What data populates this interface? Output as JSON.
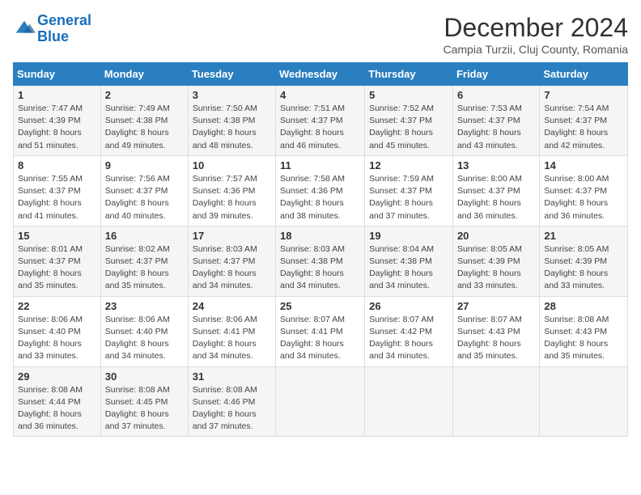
{
  "header": {
    "logo_line1": "General",
    "logo_line2": "Blue",
    "month_title": "December 2024",
    "subtitle": "Campia Turzii, Cluj County, Romania"
  },
  "days_of_week": [
    "Sunday",
    "Monday",
    "Tuesday",
    "Wednesday",
    "Thursday",
    "Friday",
    "Saturday"
  ],
  "weeks": [
    [
      {
        "day": "1",
        "sunrise": "7:47 AM",
        "sunset": "4:39 PM",
        "daylight": "8 hours and 51 minutes."
      },
      {
        "day": "2",
        "sunrise": "7:49 AM",
        "sunset": "4:38 PM",
        "daylight": "8 hours and 49 minutes."
      },
      {
        "day": "3",
        "sunrise": "7:50 AM",
        "sunset": "4:38 PM",
        "daylight": "8 hours and 48 minutes."
      },
      {
        "day": "4",
        "sunrise": "7:51 AM",
        "sunset": "4:37 PM",
        "daylight": "8 hours and 46 minutes."
      },
      {
        "day": "5",
        "sunrise": "7:52 AM",
        "sunset": "4:37 PM",
        "daylight": "8 hours and 45 minutes."
      },
      {
        "day": "6",
        "sunrise": "7:53 AM",
        "sunset": "4:37 PM",
        "daylight": "8 hours and 43 minutes."
      },
      {
        "day": "7",
        "sunrise": "7:54 AM",
        "sunset": "4:37 PM",
        "daylight": "8 hours and 42 minutes."
      }
    ],
    [
      {
        "day": "8",
        "sunrise": "7:55 AM",
        "sunset": "4:37 PM",
        "daylight": "8 hours and 41 minutes."
      },
      {
        "day": "9",
        "sunrise": "7:56 AM",
        "sunset": "4:37 PM",
        "daylight": "8 hours and 40 minutes."
      },
      {
        "day": "10",
        "sunrise": "7:57 AM",
        "sunset": "4:36 PM",
        "daylight": "8 hours and 39 minutes."
      },
      {
        "day": "11",
        "sunrise": "7:58 AM",
        "sunset": "4:36 PM",
        "daylight": "8 hours and 38 minutes."
      },
      {
        "day": "12",
        "sunrise": "7:59 AM",
        "sunset": "4:37 PM",
        "daylight": "8 hours and 37 minutes."
      },
      {
        "day": "13",
        "sunrise": "8:00 AM",
        "sunset": "4:37 PM",
        "daylight": "8 hours and 36 minutes."
      },
      {
        "day": "14",
        "sunrise": "8:00 AM",
        "sunset": "4:37 PM",
        "daylight": "8 hours and 36 minutes."
      }
    ],
    [
      {
        "day": "15",
        "sunrise": "8:01 AM",
        "sunset": "4:37 PM",
        "daylight": "8 hours and 35 minutes."
      },
      {
        "day": "16",
        "sunrise": "8:02 AM",
        "sunset": "4:37 PM",
        "daylight": "8 hours and 35 minutes."
      },
      {
        "day": "17",
        "sunrise": "8:03 AM",
        "sunset": "4:37 PM",
        "daylight": "8 hours and 34 minutes."
      },
      {
        "day": "18",
        "sunrise": "8:03 AM",
        "sunset": "4:38 PM",
        "daylight": "8 hours and 34 minutes."
      },
      {
        "day": "19",
        "sunrise": "8:04 AM",
        "sunset": "4:38 PM",
        "daylight": "8 hours and 34 minutes."
      },
      {
        "day": "20",
        "sunrise": "8:05 AM",
        "sunset": "4:39 PM",
        "daylight": "8 hours and 33 minutes."
      },
      {
        "day": "21",
        "sunrise": "8:05 AM",
        "sunset": "4:39 PM",
        "daylight": "8 hours and 33 minutes."
      }
    ],
    [
      {
        "day": "22",
        "sunrise": "8:06 AM",
        "sunset": "4:40 PM",
        "daylight": "8 hours and 33 minutes."
      },
      {
        "day": "23",
        "sunrise": "8:06 AM",
        "sunset": "4:40 PM",
        "daylight": "8 hours and 34 minutes."
      },
      {
        "day": "24",
        "sunrise": "8:06 AM",
        "sunset": "4:41 PM",
        "daylight": "8 hours and 34 minutes."
      },
      {
        "day": "25",
        "sunrise": "8:07 AM",
        "sunset": "4:41 PM",
        "daylight": "8 hours and 34 minutes."
      },
      {
        "day": "26",
        "sunrise": "8:07 AM",
        "sunset": "4:42 PM",
        "daylight": "8 hours and 34 minutes."
      },
      {
        "day": "27",
        "sunrise": "8:07 AM",
        "sunset": "4:43 PM",
        "daylight": "8 hours and 35 minutes."
      },
      {
        "day": "28",
        "sunrise": "8:08 AM",
        "sunset": "4:43 PM",
        "daylight": "8 hours and 35 minutes."
      }
    ],
    [
      {
        "day": "29",
        "sunrise": "8:08 AM",
        "sunset": "4:44 PM",
        "daylight": "8 hours and 36 minutes."
      },
      {
        "day": "30",
        "sunrise": "8:08 AM",
        "sunset": "4:45 PM",
        "daylight": "8 hours and 37 minutes."
      },
      {
        "day": "31",
        "sunrise": "8:08 AM",
        "sunset": "4:46 PM",
        "daylight": "8 hours and 37 minutes."
      },
      null,
      null,
      null,
      null
    ]
  ]
}
